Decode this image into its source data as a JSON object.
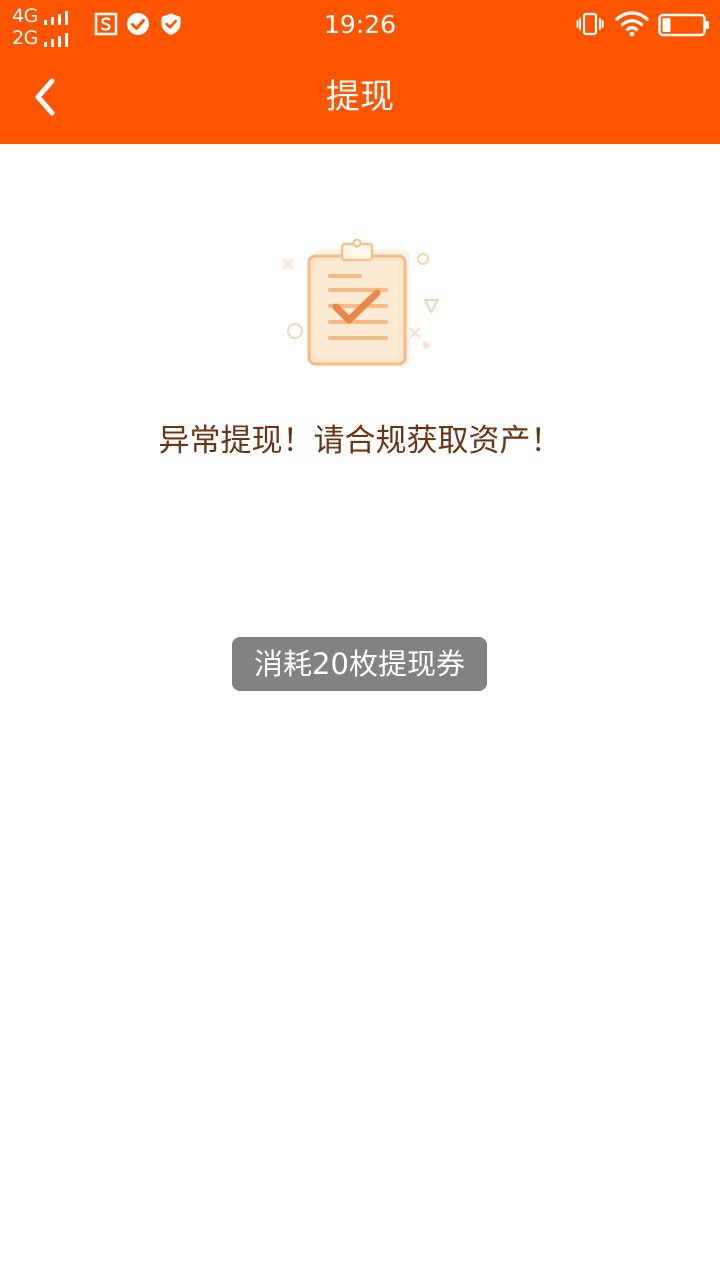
{
  "status_bar": {
    "network_line1": "4G",
    "network_line2": "2G",
    "time": "19:26",
    "icons": [
      "sim-s-icon",
      "check-circle-icon",
      "shield-check-icon",
      "vibrate-icon",
      "wifi-icon",
      "battery-icon"
    ],
    "battery_level": 0.2
  },
  "nav": {
    "title": "提现",
    "back_icon": "chevron-left-icon"
  },
  "content": {
    "illustration_icon": "clipboard-check-icon",
    "message": "异常提现！请合规获取资产！"
  },
  "toast": {
    "text": "消耗20枚提现券"
  },
  "colors": {
    "header": "#ff5500",
    "message": "#6b3515",
    "toast_bg": "#666666",
    "illustration_stroke": "#f0a868",
    "illustration_fill": "#fde6cc"
  }
}
